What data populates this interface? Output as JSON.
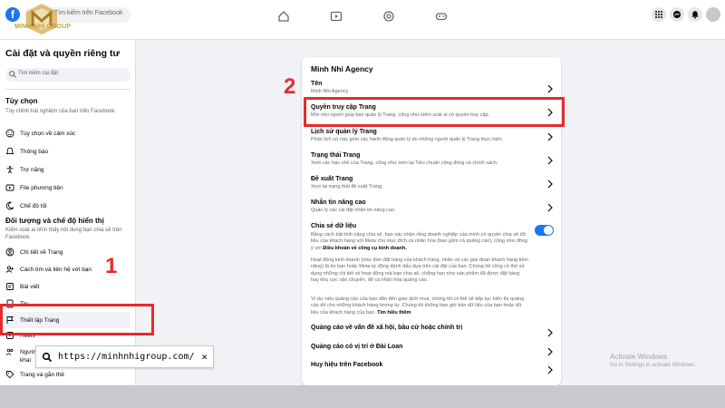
{
  "topbar": {
    "logo_letter": "f",
    "search_placeholder": "Tìm kiếm trên Facebook",
    "brand_text": "MINH NHI GROUP"
  },
  "sidebar": {
    "title": "Cài đặt và quyền riêng tư",
    "search_placeholder": "Tìm kiếm cài đặt",
    "section1_heading": "Tùy chọn",
    "section1_desc": "Tùy chỉnh trải nghiệm của bạn trên Facebook.",
    "section1_items": [
      {
        "label": "Tùy chọn về cảm xúc",
        "icon": "smile-icon"
      },
      {
        "label": "Thông báo",
        "icon": "bell-icon"
      },
      {
        "label": "Trợ năng",
        "icon": "accessibility-icon"
      },
      {
        "label": "File phương tiện",
        "icon": "media-icon"
      },
      {
        "label": "Chế độ tối",
        "icon": "moon-icon"
      }
    ],
    "section2_heading": "Đối tượng và chế độ hiển thị",
    "section2_desc": "Kiểm soát ai nhìn thấy nội dung bạn chia sẻ trên Facebook.",
    "section2_items": [
      {
        "label": "Chi tiết về Trang",
        "icon": "user-icon"
      },
      {
        "label": "Cách tìm và liên hệ với bạn",
        "icon": "contact-icon"
      },
      {
        "label": "Bài viết",
        "icon": "post-icon"
      },
      {
        "label": "Tin",
        "icon": "story-icon"
      },
      {
        "label": "Thiết lập Trang",
        "icon": "flag-icon"
      },
      {
        "label": "Reels",
        "icon": "reels-icon"
      },
      {
        "label": "Người",
        "icon": "people-icon"
      },
      {
        "label": "khai",
        "icon": ""
      },
      {
        "label": "Trang và gắn thẻ",
        "icon": "tag-icon"
      }
    ]
  },
  "url_tooltip": {
    "url": "https://minhnhigroup.com/",
    "close": "×"
  },
  "card": {
    "title": "Minh Nhi Agency",
    "rows": [
      {
        "title": "Tên",
        "desc": "Minh Nhi Agency"
      },
      {
        "title": "Quyền truy cập Trang",
        "desc": "Mời mọi người giúp bạn quản lý Trang, cũng như kiểm soát ai có quyền truy cập."
      },
      {
        "title": "Lịch sử quản lý Trang",
        "desc": "Phần lịch sử này gồm các hành động quản lý do những người quản lý Trang thực hiện."
      },
      {
        "title": "Trạng thái Trang",
        "desc": "Xem các hạn chế của Trang, cũng như xem lại Tiêu chuẩn cộng đồng và chính sách."
      },
      {
        "title": "Đề xuất Trang",
        "desc": "Xem lại trạng thái đề xuất Trang."
      },
      {
        "title": "Nhắn tin nâng cao",
        "desc": "Quản lý các cài đặt nhắn tin nâng cao."
      }
    ],
    "share": {
      "title": "Chia sẻ dữ liệu",
      "p1": "Bằng cách bật tính năng chia sẻ, bạn xác nhận rằng doanh nghiệp của mình có quyền chia sẻ dữ liệu của khách hàng với Meta cho mục đích cá nhân hóa (bao gồm cả quảng cáo), cũng như đồng ý với",
      "p1_bold": "Điều khoản về công cụ kinh doanh.",
      "p2": "Hoạt động kinh doanh (như đơn đặt hàng của khách hàng, nhãn và các giai đoạn khách hàng tiềm năng) là do bạn hoặc Meta tự động đánh dấu dựa trên cài đặt của bạn. Chúng tôi cũng có thể sử dụng những chi tiết về hoạt động mà bạn chia sẻ, chẳng hạn như sản phẩm đã được đặt hàng hay khu vực vận chuyển, để cá nhân hóa quảng cáo.",
      "p3": "Ví dụ: nếu quảng cáo của bạn dẫn đến giao dịch mua, chúng tôi có thể sẽ tiếp tục hiển thị quảng cáo đó cho những khách hàng tương tự. Chúng tôi không bao giờ bán dữ liệu của bạn hoặc dữ liệu của khách hàng của bạn.",
      "p3_link": "Tìm hiểu thêm"
    },
    "bottom_rows": [
      {
        "title": "Quảng cáo về vấn đề xã hội, bầu cử hoặc chính trị"
      },
      {
        "title": "Quảng cáo có vị trí ở Đài Loan"
      },
      {
        "title": "Huy hiệu trên Facebook"
      }
    ]
  },
  "annotations": {
    "step1": "1",
    "step2": "2",
    "color": "#e82a2a"
  },
  "watermark": {
    "line1": "Activate Windows",
    "line2": "Go to Settings to activate Windows."
  },
  "colors": {
    "accent": "#1877f2",
    "highlight": "#e82a2a"
  }
}
